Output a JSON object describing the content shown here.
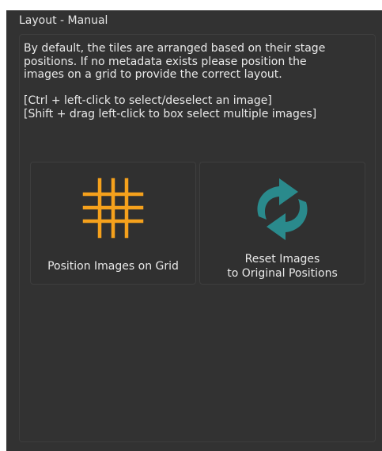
{
  "panel": {
    "title": "Layout - Manual"
  },
  "description": {
    "lines": [
      "By default, the tiles are arranged based on their stage",
      "positions. If no metadata exists please position the",
      "images on a grid to provide the correct layout.",
      "[Ctrl + left-click to select/deselect an image]",
      "[Shift + drag left-click to box select multiple images]"
    ]
  },
  "buttons": {
    "grid": {
      "label": "Position Images on Grid",
      "icon": "grid-icon"
    },
    "reset": {
      "label_line1": "Reset Images",
      "label_line2": "to Original Positions",
      "icon": "reset-arrows-icon"
    }
  },
  "colors": {
    "panel_background": "#323232",
    "grid_icon": "#f5a11c",
    "reset_icon": "#2a8a8c",
    "text": "#e9e9e9"
  }
}
